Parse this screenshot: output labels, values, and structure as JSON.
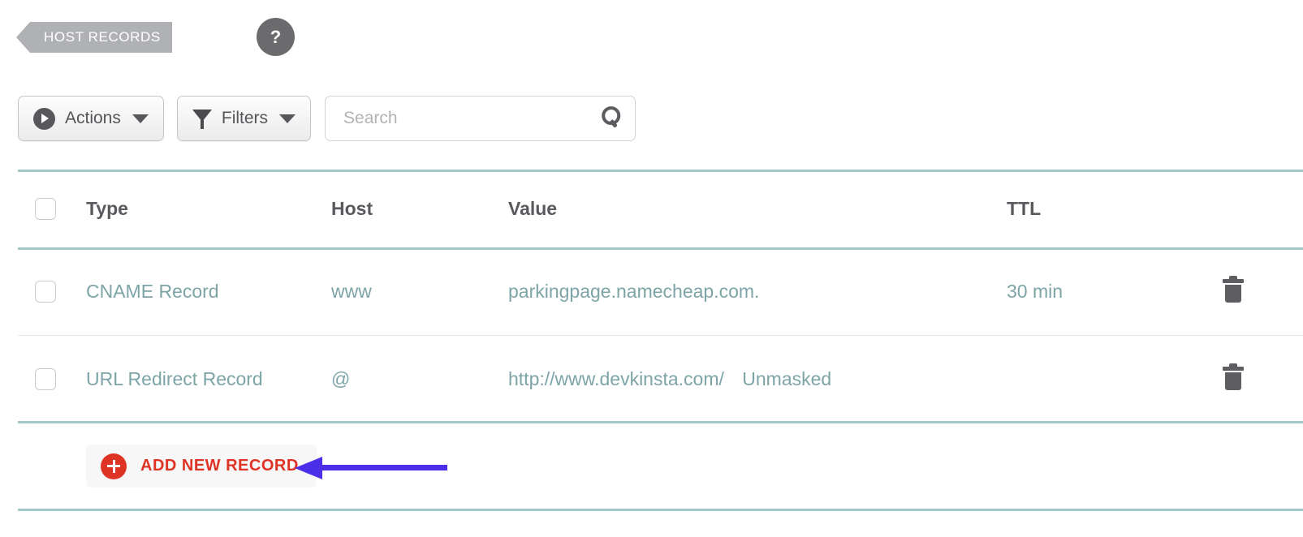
{
  "header": {
    "ribbon_label": "HOST RECORDS",
    "help_icon": "question-mark-icon",
    "help_label": "?"
  },
  "toolbar": {
    "actions_label": "Actions",
    "actions_icon": "play-circle-icon",
    "filters_label": "Filters",
    "filters_icon": "funnel-icon",
    "caret_icon": "chevron-down-icon",
    "search_placeholder": "Search",
    "search_value": "",
    "search_icon": "magnifier-icon"
  },
  "table": {
    "columns": [
      "Type",
      "Host",
      "Value",
      "TTL"
    ],
    "rows": [
      {
        "type": "CNAME Record",
        "host": "www",
        "value": "parkingpage.namecheap.com.",
        "value_extra": "",
        "ttl": "30 min",
        "delete_icon": "trash-icon"
      },
      {
        "type": "URL Redirect Record",
        "host": "@",
        "value": "http://www.devkinsta.com/",
        "value_extra": "Unmasked",
        "ttl": "",
        "delete_icon": "trash-icon"
      }
    ]
  },
  "footer": {
    "add_label": "ADD NEW RECORD",
    "add_icon": "plus-circle-icon"
  },
  "annotation": {
    "arrow_icon": "left-arrow-icon",
    "arrow_color": "#4b2fe8"
  },
  "colors": {
    "rule_teal": "#a3c6c9",
    "rule_gray": "#e6e6e6",
    "data_text": "#7da4a7",
    "header_text": "#5a5a5e",
    "accent_red": "#de3426",
    "ribbon_gray": "#b0b1b4",
    "help_gray": "#6b6b6d"
  }
}
